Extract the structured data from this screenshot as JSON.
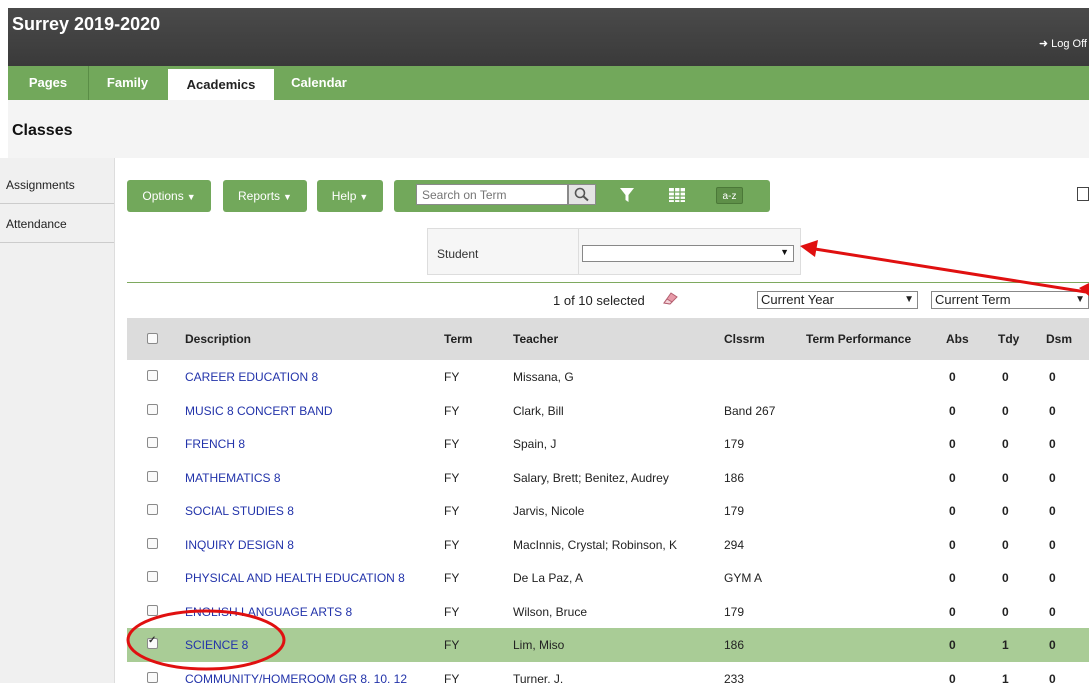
{
  "app": {
    "title": "Surrey 2019-2020",
    "logoff": "Log Off"
  },
  "nav": {
    "tabs": [
      "Pages",
      "Family",
      "Academics",
      "Calendar"
    ],
    "active": "Academics"
  },
  "page": {
    "heading": "Classes"
  },
  "sidebar": {
    "items": [
      {
        "label": "Assignments"
      },
      {
        "label": "Attendance"
      }
    ]
  },
  "toolbar": {
    "options_label": "Options",
    "reports_label": "Reports",
    "help_label": "Help",
    "search_placeholder": "Search on Term",
    "az_label": "a-z"
  },
  "filter": {
    "label": "Student",
    "value": ""
  },
  "selection": {
    "text": "1 of 10 selected",
    "year": "Current Year",
    "term": "Current Term"
  },
  "table": {
    "columns": [
      "Description",
      "Term",
      "Teacher",
      "Clssrm",
      "Term Performance",
      "Abs",
      "Tdy",
      "Dsm"
    ],
    "rows": [
      {
        "description": "CAREER EDUCATION 8",
        "term": "FY",
        "teacher": "Missana, G",
        "room": "",
        "perf": "",
        "abs": "0",
        "tdy": "0",
        "dsm": "0",
        "checked": false
      },
      {
        "description": "MUSIC 8 CONCERT BAND",
        "term": "FY",
        "teacher": "Clark, Bill",
        "room": "Band 267",
        "perf": "",
        "abs": "0",
        "tdy": "0",
        "dsm": "0",
        "checked": false
      },
      {
        "description": "FRENCH 8",
        "term": "FY",
        "teacher": "Spain, J",
        "room": "179",
        "perf": "",
        "abs": "0",
        "tdy": "0",
        "dsm": "0",
        "checked": false
      },
      {
        "description": "MATHEMATICS 8",
        "term": "FY",
        "teacher": "Salary, Brett; Benitez, Audrey",
        "room": "186",
        "perf": "",
        "abs": "0",
        "tdy": "0",
        "dsm": "0",
        "checked": false
      },
      {
        "description": "SOCIAL STUDIES 8",
        "term": "FY",
        "teacher": "Jarvis, Nicole",
        "room": "179",
        "perf": "",
        "abs": "0",
        "tdy": "0",
        "dsm": "0",
        "checked": false
      },
      {
        "description": "INQUIRY DESIGN 8",
        "term": "FY",
        "teacher": "MacInnis, Crystal; Robinson, K",
        "room": "294",
        "perf": "",
        "abs": "0",
        "tdy": "0",
        "dsm": "0",
        "checked": false
      },
      {
        "description": "PHYSICAL AND HEALTH EDUCATION 8",
        "term": "FY",
        "teacher": "De La Paz, A",
        "room": "GYM A",
        "perf": "",
        "abs": "0",
        "tdy": "0",
        "dsm": "0",
        "checked": false
      },
      {
        "description": "ENGLISH LANGUAGE ARTS 8",
        "term": "FY",
        "teacher": "Wilson, Bruce",
        "room": "179",
        "perf": "",
        "abs": "0",
        "tdy": "0",
        "dsm": "0",
        "checked": false
      },
      {
        "description": "SCIENCE 8",
        "term": "FY",
        "teacher": "Lim, Miso",
        "room": "186",
        "perf": "",
        "abs": "0",
        "tdy": "1",
        "dsm": "0",
        "checked": true
      },
      {
        "description": "COMMUNITY/HOMEROOM GR 8, 10, 12",
        "term": "FY",
        "teacher": "Turner, J.",
        "room": "233",
        "perf": "",
        "abs": "0",
        "tdy": "1",
        "dsm": "0",
        "checked": false
      }
    ]
  },
  "colors": {
    "header": "#3f3f3f",
    "nav": "#72a85b",
    "selected_row": "#a9cc96",
    "link": "#2233aa",
    "annotation": "#e01010"
  }
}
